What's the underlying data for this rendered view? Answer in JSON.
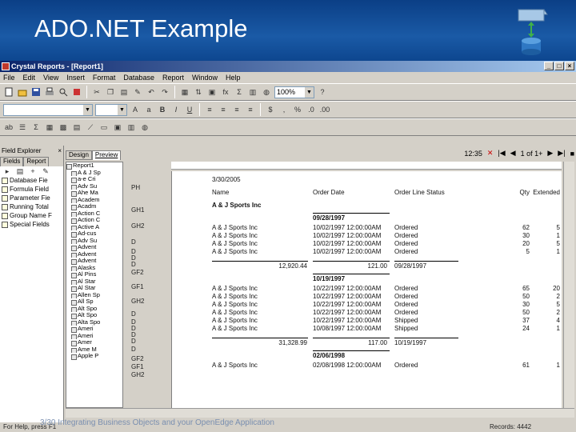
{
  "slide": {
    "title": "ADO.NET Example",
    "footer": "3/30 Integrating Business Objects and your OpenEdge Application",
    "accent": "#0b3f86"
  },
  "window": {
    "title": "Crystal Reports - [Report1]"
  },
  "menu": [
    "File",
    "Edit",
    "View",
    "Insert",
    "Format",
    "Database",
    "Report",
    "Window",
    "Help"
  ],
  "toolbar": {
    "zoom": "100%"
  },
  "field_explorer": {
    "title": "Field Explorer",
    "tabs": [
      "Fields",
      "Report"
    ],
    "items": [
      "Database Fie",
      "Formula Field",
      "Parameter Fie",
      "Running Total",
      "Group Name F",
      "Special Fields"
    ]
  },
  "report_tabs": [
    "Design",
    "Preview"
  ],
  "nav": {
    "time": "12:35",
    "page": "1 of 1+"
  },
  "tree": {
    "root": "Report1",
    "items": [
      "A & J Sp",
      "a-e Cri",
      "Adv Su",
      "Ahe Ma",
      "Academ",
      "Acadm",
      "Action C",
      "Action C",
      "Active A",
      "Ad-cus",
      "Adv Su",
      "Advent",
      "Advent",
      "Advent",
      "Alasks",
      "Al Pins",
      "Al Star",
      "Al Star",
      "Allen Sp",
      "All Sp",
      "Alt Spo",
      "Alt Spo",
      "Alta Spo",
      "Ameri",
      "Ameri",
      "Amer",
      "Ame M",
      "Apple P"
    ]
  },
  "sections": [
    "PH",
    "GH1",
    "GH2",
    "D",
    "D",
    "D",
    "D",
    "GF2",
    "GF1",
    "GH2",
    "D",
    "D",
    "D",
    "D",
    "D",
    "D",
    "GF2",
    "GF1",
    "GH2"
  ],
  "report": {
    "date": "3/30/2005",
    "headers": [
      "Name",
      "Order Date",
      "Order Line Status",
      "Qty",
      "Extended"
    ],
    "customer": "A & J Sports Inc",
    "groups": [
      {
        "date_header": "09/28/1997",
        "rows": [
          [
            "A & J Sports Inc",
            "10/02/1997 12:00:00AM",
            "Ordered",
            "62",
            "5"
          ],
          [
            "A & J Sports Inc",
            "10/02/1997 12:00:00AM",
            "Ordered",
            "30",
            "1"
          ],
          [
            "A & J Sports Inc",
            "10/02/1997 12:00:00AM",
            "Ordered",
            "20",
            "5"
          ],
          [
            "A & J Sports Inc",
            "10/02/1997 12:00:00AM",
            "Ordered",
            "5",
            "1"
          ]
        ],
        "subtotal": [
          "12,920.44",
          "121.00",
          "09/28/1997"
        ]
      },
      {
        "date_header": "10/19/1997",
        "rows": [
          [
            "A & J Sports Inc",
            "10/22/1997 12:00:00AM",
            "Ordered",
            "65",
            "20"
          ],
          [
            "A & J Sports Inc",
            "10/22/1997 12:00:00AM",
            "Ordered",
            "50",
            "2"
          ],
          [
            "A & J Sports Inc",
            "10/22/1997 12:00:00AM",
            "Ordered",
            "30",
            "5"
          ],
          [
            "A & J Sports Inc",
            "10/22/1997 12:00:00AM",
            "Ordered",
            "50",
            "2"
          ],
          [
            "A & J Sports Inc",
            "10/22/1997 12:00:00AM",
            "Shipped",
            "37",
            "4"
          ],
          [
            "A & J Sports Inc",
            "10/08/1997 12:00:00AM",
            "Shipped",
            "24",
            "1"
          ]
        ],
        "subtotal": [
          "31,328.99",
          "117.00",
          "10/19/1997"
        ]
      },
      {
        "date_header": "02/06/1998",
        "rows": [
          [
            "A & J Sports Inc",
            "02/08/1998 12:00:00AM",
            "Ordered",
            "61",
            "1"
          ]
        ]
      }
    ]
  },
  "statusbar": {
    "left": "For Help, press F1",
    "right": "Records: 4442"
  }
}
